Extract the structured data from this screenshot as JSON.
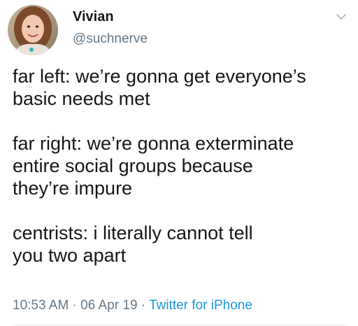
{
  "user": {
    "display_name": "Vivian",
    "handle": "@suchnerve"
  },
  "tweet": {
    "paragraphs": [
      [
        "far left: we’re gonna get everyone’s",
        "basic needs met"
      ],
      [
        "far right: we’re gonna exterminate",
        "entire social groups because",
        "they’re impure"
      ],
      [
        "centrists: i literally cannot tell",
        "you two apart"
      ]
    ],
    "time": "10:53 AM",
    "separator": "·",
    "date": "06 Apr 19",
    "source": "Twitter for iPhone"
  },
  "icons": {
    "avatar": "profile-photo",
    "menu": "chevron-down-icon"
  },
  "colors": {
    "text": "#14171a",
    "secondary": "#657786",
    "link": "#1b95e0",
    "divider": "#e1e8ed"
  }
}
